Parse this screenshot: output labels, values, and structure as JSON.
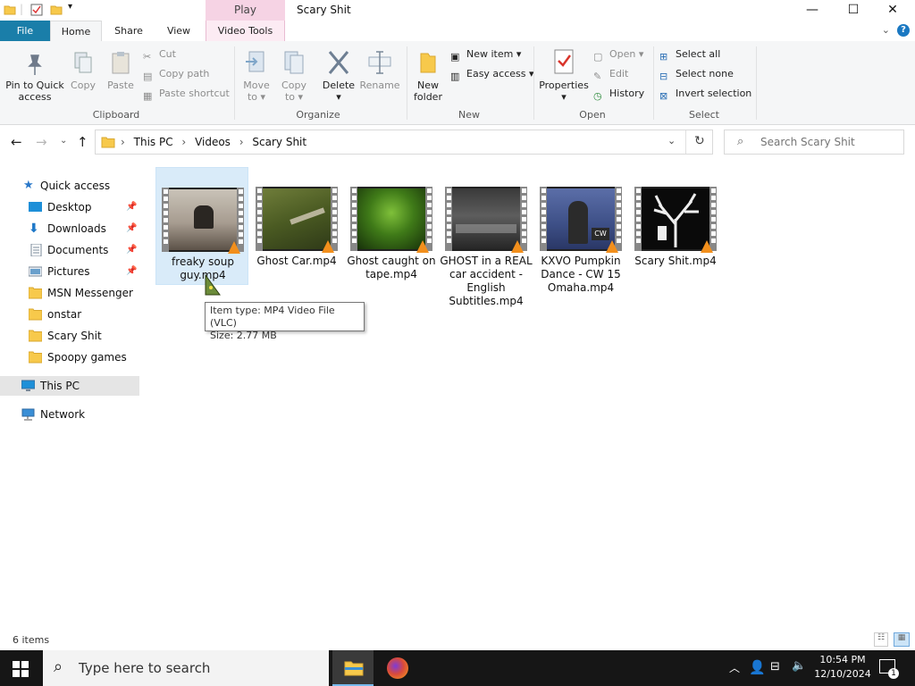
{
  "window": {
    "title": "Scary Shit",
    "context_tab": "Play",
    "controls": {
      "minimize": "—",
      "maximize": "☐",
      "close": "✕"
    }
  },
  "ribbon_tabs": [
    "File",
    "Home",
    "Share",
    "View",
    "Video Tools"
  ],
  "ribbon": {
    "clipboard": {
      "label": "Clipboard",
      "pin": "Pin to Quick access",
      "copy": "Copy",
      "paste": "Paste",
      "cut": "Cut",
      "copy_path": "Copy path",
      "paste_shortcut": "Paste shortcut"
    },
    "organize": {
      "label": "Organize",
      "move_to": "Move to",
      "copy_to": "Copy to",
      "delete": "Delete",
      "rename": "Rename"
    },
    "new": {
      "label": "New",
      "new_folder": "New folder",
      "new_item": "New item",
      "easy_access": "Easy access"
    },
    "open": {
      "label": "Open",
      "properties": "Properties",
      "open": "Open",
      "edit": "Edit",
      "history": "History"
    },
    "select": {
      "label": "Select",
      "select_all": "Select all",
      "select_none": "Select none",
      "invert": "Invert selection"
    }
  },
  "address": {
    "path": [
      "This PC",
      "Videos",
      "Scary Shit"
    ],
    "search_placeholder": "Search Scary Shit"
  },
  "sidebar": {
    "quick_access": "Quick access",
    "items": [
      {
        "label": "Desktop",
        "pinned": true
      },
      {
        "label": "Downloads",
        "pinned": true
      },
      {
        "label": "Documents",
        "pinned": true
      },
      {
        "label": "Pictures",
        "pinned": true
      },
      {
        "label": "MSN Messenger",
        "pinned": false
      },
      {
        "label": "onstar",
        "pinned": false
      },
      {
        "label": "Scary Shit",
        "pinned": false
      },
      {
        "label": "Spoopy games",
        "pinned": false
      }
    ],
    "this_pc": "This PC",
    "network": "Network"
  },
  "files": [
    {
      "name": "freaky soup guy.mp4",
      "selected": true
    },
    {
      "name": "Ghost Car.mp4",
      "selected": false
    },
    {
      "name": "Ghost caught on tape.mp4",
      "selected": false
    },
    {
      "name": "GHOST in a REAL car accident - English Subtitles.mp4",
      "selected": false
    },
    {
      "name": "KXVO Pumpkin Dance - CW 15 Omaha.mp4",
      "selected": false
    },
    {
      "name": "Scary Shit.mp4",
      "selected": false
    }
  ],
  "tooltip": {
    "line1": "Item type: MP4 Video File (VLC)",
    "line2": "Size: 2.77 MB"
  },
  "status": {
    "count": "6 items"
  },
  "taskbar": {
    "search_placeholder": "Type here to search",
    "time": "10:54 PM",
    "date": "12/10/2024",
    "notification_count": "1"
  },
  "colors": {
    "file_tab": "#1a7ea9",
    "play_tab": "#f6d3e4",
    "selection": "#d9ebf9",
    "folder": "#f7c94b",
    "vlc_cone": "#f28f1c"
  }
}
